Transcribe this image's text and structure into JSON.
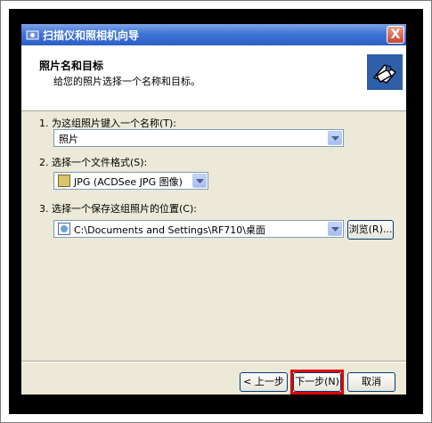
{
  "window": {
    "title": "扫描仪和照相机向导",
    "close_glyph": "X"
  },
  "header": {
    "title": "照片名和目标",
    "subtitle": "给您的照片选择一个名称和目标。",
    "icon": "camera-scanner-icon"
  },
  "steps": [
    {
      "label": "1. 为这组照片键入一个名称(T):",
      "value": "照片"
    },
    {
      "label": "2. 选择一个文件格式(S):",
      "value": "JPG (ACDSee JPG 图像)",
      "icon": "jpg-file-icon"
    },
    {
      "label": "3. 选择一个保存这组照片的位置(C):",
      "value": "C:\\Documents and Settings\\RF710\\桌面",
      "icon": "folder-icon"
    }
  ],
  "buttons": {
    "browse": "浏览(R)...",
    "back": "< 上一步(B)",
    "next": "下一步(N) >",
    "cancel": "取消"
  },
  "colors": {
    "highlight": "#e00000",
    "titlebar": "#2d60c8",
    "dialog_bg": "#ece9d8"
  }
}
